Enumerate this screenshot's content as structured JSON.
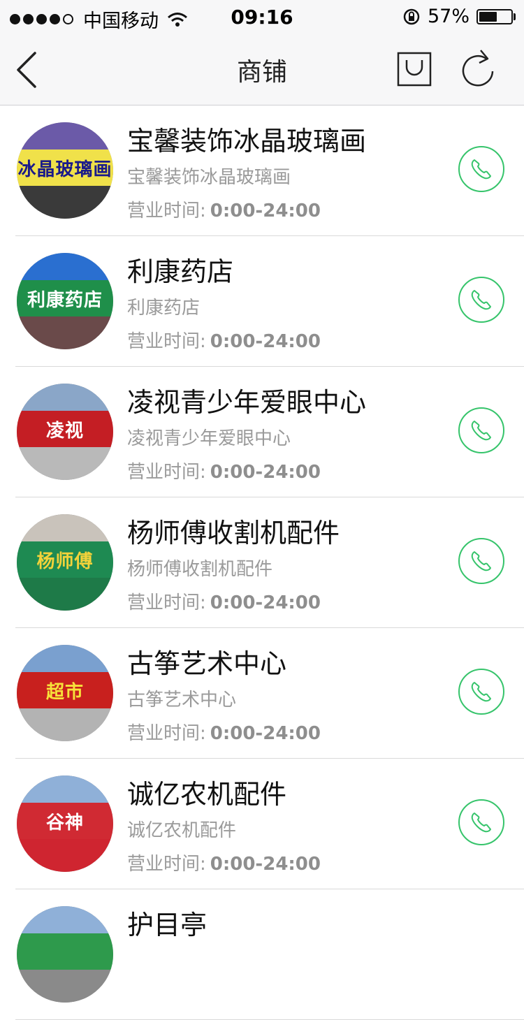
{
  "status_bar": {
    "carrier": "中国移动",
    "time": "09:16",
    "battery_percent": "57%",
    "battery_level": 0.57,
    "signal_bars": 4
  },
  "nav": {
    "title": "商铺",
    "icons": [
      "back-chevron-icon",
      "shopping-bag-icon",
      "refresh-icon"
    ]
  },
  "shop_list": {
    "hours_label": "营业时间:",
    "items": [
      {
        "name": "宝馨装饰冰晶玻璃画",
        "subtitle": "宝馨装饰冰晶玻璃画",
        "hours": "0:00-24:00",
        "photo_text": "冰晶玻璃画",
        "sign_color": "#f0e14a",
        "text_color": "#1a1a8a",
        "sky_color": "#6b5aa8",
        "base_color": "#3a3a3a"
      },
      {
        "name": "利康药店",
        "subtitle": "利康药店",
        "hours": "0:00-24:00",
        "photo_text": "利康药店",
        "sign_color": "#1f8f4a",
        "text_color": "#ffffff",
        "sky_color": "#2a6fd0",
        "base_color": "#6a4a4a"
      },
      {
        "name": "凌视青少年爱眼中心",
        "subtitle": "凌视青少年爱眼中心",
        "hours": "0:00-24:00",
        "photo_text": "凌视",
        "sign_color": "#c41e24",
        "text_color": "#ffffff",
        "sky_color": "#8aa6c8",
        "base_color": "#b9b9b9"
      },
      {
        "name": "杨师傅收割机配件",
        "subtitle": "杨师傅收割机配件",
        "hours": "0:00-24:00",
        "photo_text": "杨师傅",
        "sign_color": "#1e8a52",
        "text_color": "#f3d23a",
        "sky_color": "#c9c3bb",
        "base_color": "#1e7a48"
      },
      {
        "name": "古筝艺术中心",
        "subtitle": "古筝艺术中心",
        "hours": "0:00-24:00",
        "photo_text": "超市",
        "sign_color": "#c8201e",
        "text_color": "#f7e23a",
        "sky_color": "#7aa0cf",
        "base_color": "#b3b3b3"
      },
      {
        "name": "诚亿农机配件",
        "subtitle": "诚亿农机配件",
        "hours": "0:00-24:00",
        "photo_text": "谷神",
        "sign_color": "#d02a33",
        "text_color": "#ffffff",
        "sky_color": "#8fb0d8",
        "base_color": "#cf2530"
      },
      {
        "name": "护目亭",
        "subtitle": "",
        "hours": "",
        "photo_text": "",
        "sign_color": "#2e9a4c",
        "text_color": "#ffffff",
        "sky_color": "#8fb0d8",
        "base_color": "#8a8a8a"
      }
    ]
  },
  "colors": {
    "accent_green": "#36c46b",
    "secondary_text": "#9a9a9a",
    "separator": "#d9d9d9",
    "navbar_bg": "#f7f7f8"
  }
}
